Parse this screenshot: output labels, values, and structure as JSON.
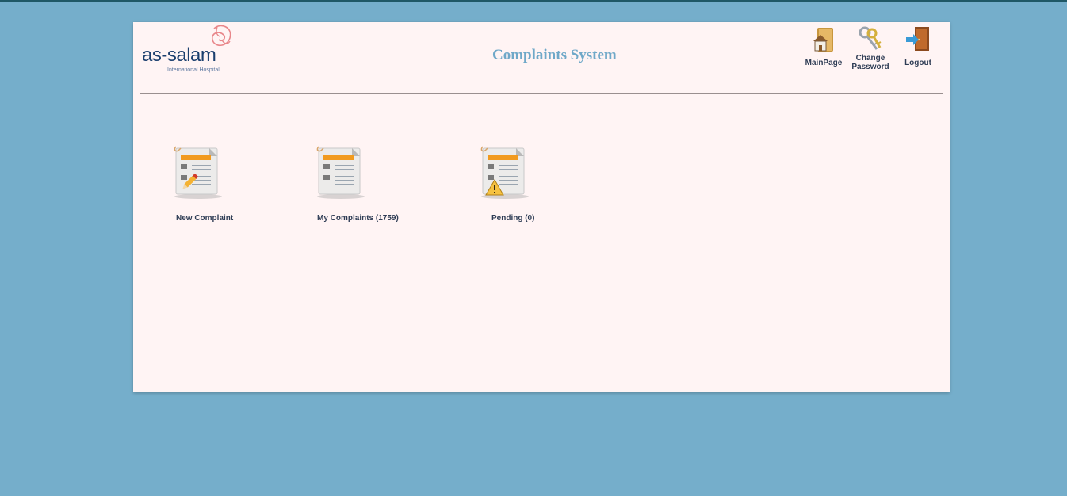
{
  "app": {
    "logo_text": "as-salam",
    "logo_subtext": "International Hospital",
    "title": "Complaints System"
  },
  "nav": {
    "main_page": "MainPage",
    "change_password_line1": "Change",
    "change_password_line2": "Password",
    "logout": "Logout"
  },
  "tiles": [
    {
      "label": "New Complaint",
      "icon": "new-complaint-icon"
    },
    {
      "label": "My Complaints (1759)",
      "icon": "my-complaints-icon"
    },
    {
      "label": "Pending (0)",
      "icon": "pending-complaints-icon"
    }
  ],
  "colors": {
    "background": "#75aecb",
    "panel": "#fff4f4",
    "title": "#6fa8c8",
    "logo_text": "#1b3f6e",
    "logo_mark": "#e8868a",
    "doc_header": "#f19a1f"
  }
}
